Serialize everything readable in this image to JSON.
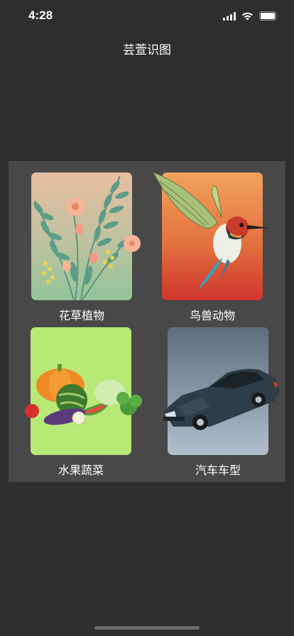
{
  "status_bar": {
    "time": "4:28",
    "icons": [
      "signal-icon",
      "wifi-icon",
      "battery-icon"
    ]
  },
  "header": {
    "title": "芸萱识图"
  },
  "categories": [
    {
      "label": "花草植物",
      "icon": "flowers-icon",
      "bg": [
        "#e7bfa0",
        "#9fc69b"
      ]
    },
    {
      "label": "鸟兽动物",
      "icon": "hummingbird-icon",
      "bg": [
        "#f0a05a",
        "#d1382c"
      ]
    },
    {
      "label": "水果蔬菜",
      "icon": "fruits-vegetables-icon",
      "bg": [
        "#b8e876",
        "#b8e876"
      ]
    },
    {
      "label": "汽车车型",
      "icon": "car-icon",
      "bg": [
        "#5d6c7a",
        "#aab8c6"
      ]
    }
  ],
  "colors": {
    "background": "#2e2e2e",
    "panel": "#484848",
    "text": "#ffffff"
  }
}
